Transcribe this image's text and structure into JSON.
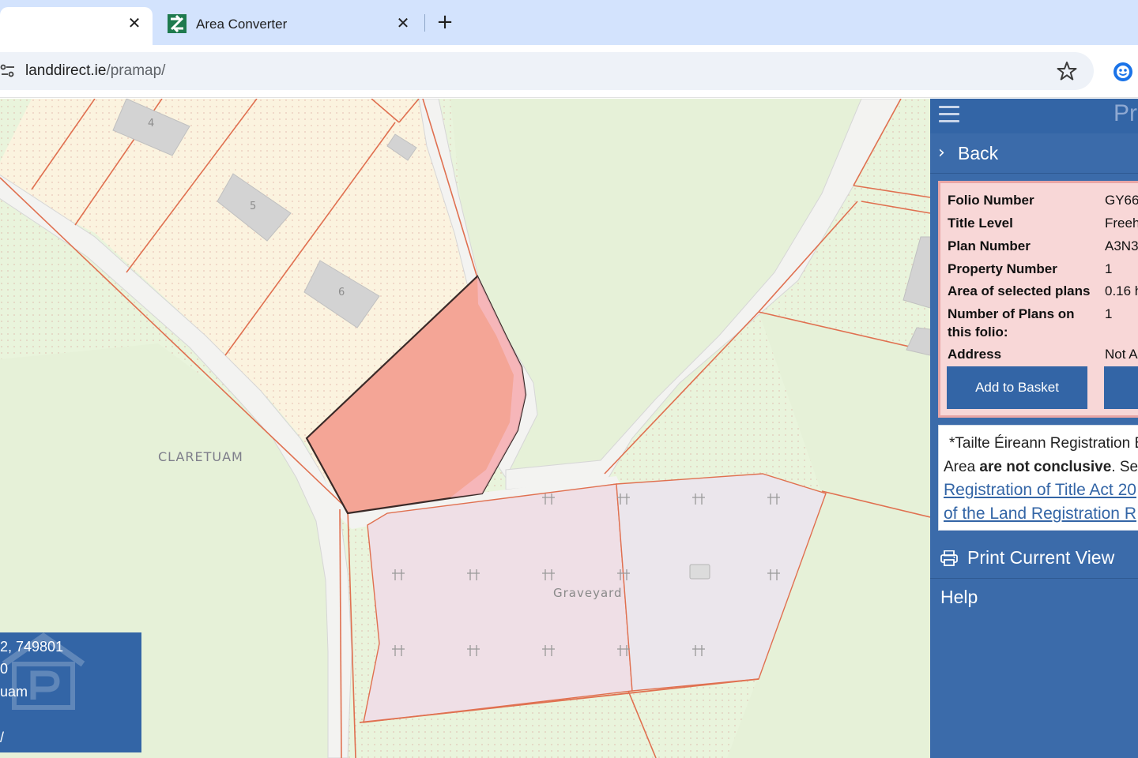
{
  "browser": {
    "tabs": [
      {
        "title": "",
        "active": true
      },
      {
        "title": "Area Converter",
        "active": false
      }
    ],
    "close_glyph": "✕",
    "new_tab_glyph": "+",
    "url_host": "landdirect.ie",
    "url_path": "/pramap/"
  },
  "map": {
    "townland_label": "CLARETUAM",
    "graveyard_label": "Graveyard",
    "house_numbers": [
      "4",
      "5",
      "6"
    ],
    "coords_box": {
      "lines": [
        "2, 749801",
        "0",
        "uam",
        "",
        "/"
      ]
    },
    "colors": {
      "background": "#e9f4dc",
      "plot_fill": "#f5b3a3",
      "parcel_line": "#e07050",
      "road": "#f2f2ef",
      "graveyard_fill": "#efdfe6"
    }
  },
  "panel": {
    "title": "Pro",
    "back_label": "Back",
    "info": [
      {
        "key": "Folio Number",
        "value": "GY66"
      },
      {
        "key": "Title Level",
        "value": "Freeh"
      },
      {
        "key": "Plan Number",
        "value": "A3N3"
      },
      {
        "key": "Property Number",
        "value": "1"
      },
      {
        "key": "Area of selected plans",
        "value": "0.16 h"
      },
      {
        "key": "Number of Plans on this folio:",
        "value": "1"
      },
      {
        "key": "Address",
        "value": "Not A"
      }
    ],
    "add_to_basket_label": "Add to Basket",
    "notice": {
      "line1": "*Tailte Éireann Registration B",
      "line2_pre": "Area ",
      "line2_bold": "are not conclusive",
      "line2_post": ". See",
      "link1": "Registration of Title Act 20",
      "link2": "of the Land Registration R"
    },
    "print_label": "Print Current View",
    "help_label": "Help",
    "colors": {
      "panel": "#3b6baa",
      "card": "#f8d7d7",
      "button": "#3365a6"
    }
  }
}
